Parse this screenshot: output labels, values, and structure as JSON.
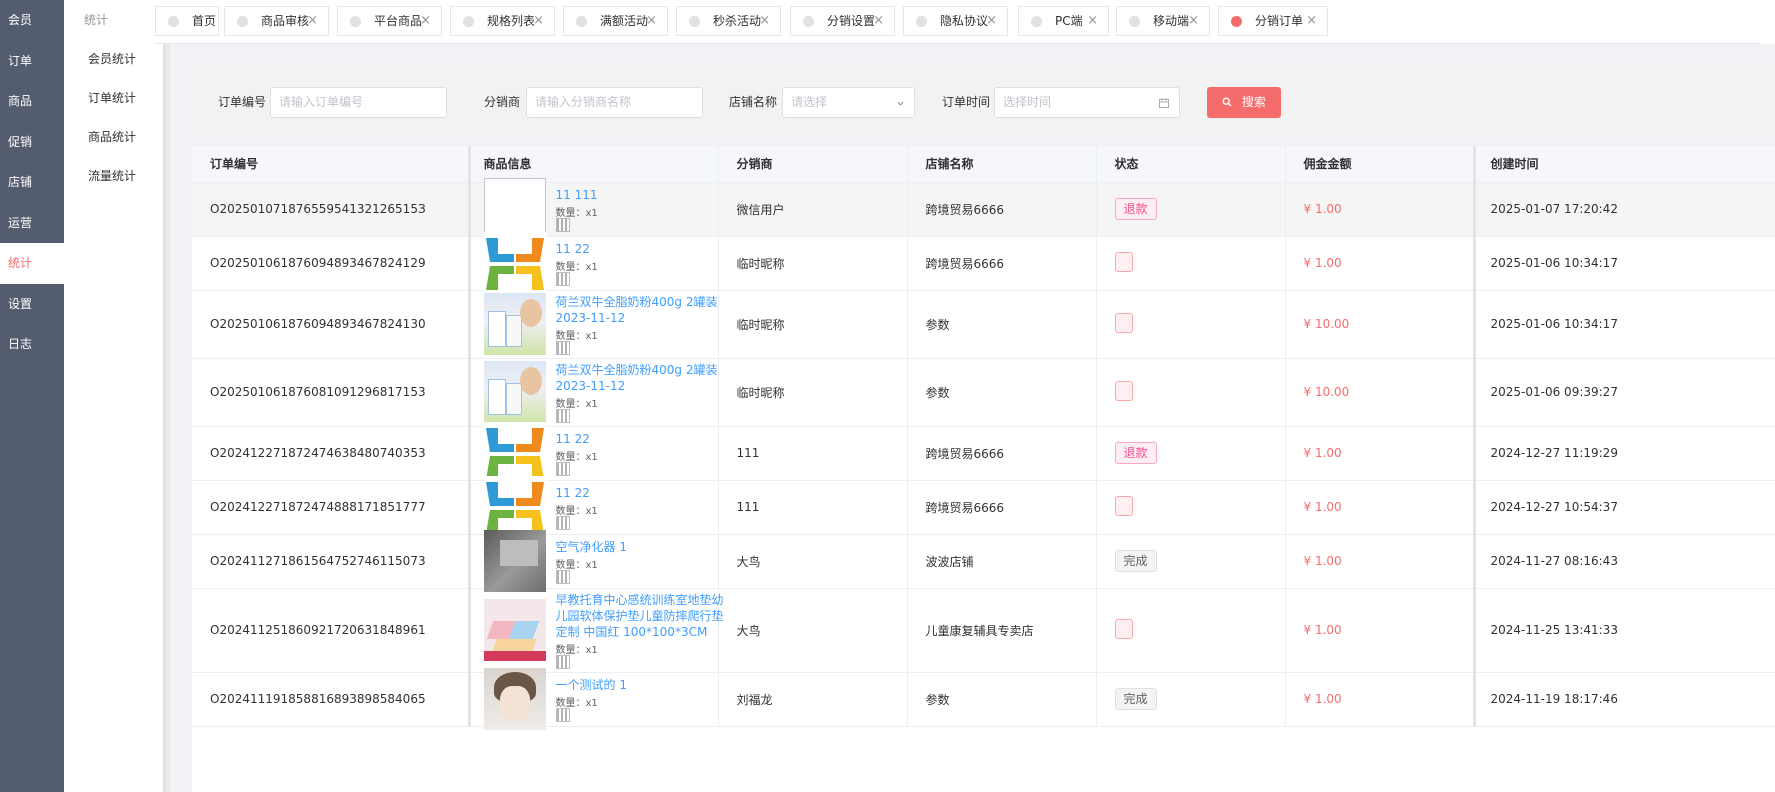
{
  "main_nav": [
    {
      "label": "会员",
      "active": false
    },
    {
      "label": "订单",
      "active": false
    },
    {
      "label": "商品",
      "active": false
    },
    {
      "label": "促销",
      "active": false
    },
    {
      "label": "店铺",
      "active": false
    },
    {
      "label": "运营",
      "active": false
    },
    {
      "label": "统计",
      "active": true
    },
    {
      "label": "设置",
      "active": false
    },
    {
      "label": "日志",
      "active": false
    }
  ],
  "sub_nav": {
    "heading": "统计",
    "items": [
      "会员统计",
      "订单统计",
      "商品统计",
      "流量统计"
    ]
  },
  "tabs": [
    {
      "label": "首页",
      "closable": false,
      "active": false
    },
    {
      "label": "商品审核",
      "closable": true,
      "active": false
    },
    {
      "label": "平台商品",
      "closable": true,
      "active": false
    },
    {
      "label": "规格列表",
      "closable": true,
      "active": false
    },
    {
      "label": "满额活动",
      "closable": true,
      "active": false
    },
    {
      "label": "秒杀活动",
      "closable": true,
      "active": false
    },
    {
      "label": "分销设置",
      "closable": true,
      "active": false
    },
    {
      "label": "隐私协议",
      "closable": true,
      "active": false
    },
    {
      "label": "PC端",
      "closable": true,
      "active": false
    },
    {
      "label": "移动端",
      "closable": true,
      "active": false
    },
    {
      "label": "分销订单",
      "closable": true,
      "active": true
    }
  ],
  "close_glyph": "×",
  "search": {
    "order_no_label": "订单编号",
    "order_no_placeholder": "请输入订单编号",
    "distributor_label": "分销商",
    "distributor_placeholder": "请输入分销商名称",
    "store_label": "店铺名称",
    "store_placeholder": "请选择",
    "time_label": "订单时间",
    "time_placeholder": "选择时间",
    "search_button": "搜索"
  },
  "table": {
    "columns": [
      "订单编号",
      "商品信息",
      "分销商",
      "店铺名称",
      "状态",
      "佣金金额",
      "创建时间"
    ],
    "qty_label": "数量：x1",
    "rows": [
      {
        "order_no": "O20250107187655954132126515З",
        "title": "11 111",
        "image": "broken",
        "distributor": "微信用户",
        "store": "跨境贸易6666",
        "status": "退款",
        "status_type": "refund",
        "commission": "¥ 1.00",
        "created": "2025-01-07 17:20:42"
      },
      {
        "order_no": "O20250106187609489346782412​9",
        "title": "11 22",
        "image": "arrows",
        "distributor": "临时昵称",
        "store": "跨境贸易6666",
        "status": "",
        "status_type": "empty",
        "commission": "¥ 1.00",
        "created": "2025-01-06 10:34:17"
      },
      {
        "order_no": "O202501061876094893467824130",
        "title": "荷兰双牛全脂奶粉400g 2罐装 2023-11-12",
        "image": "milk",
        "distributor": "临时昵称",
        "store": "参数",
        "status": "",
        "status_type": "empty",
        "commission": "¥ 10.00",
        "created": "2025-01-06 10:34:17"
      },
      {
        "order_no": "O202501061876081091296817153",
        "title": "荷兰双牛全脂奶粉400g 2罐装 2023-11-12",
        "image": "milk",
        "distributor": "临时昵称",
        "store": "参数",
        "status": "",
        "status_type": "empty",
        "commission": "¥ 10.00",
        "created": "2025-01-06 09:39:27"
      },
      {
        "order_no": "O202412271872474638480740353",
        "title": "11 22",
        "image": "arrows",
        "distributor": "111",
        "store": "跨境贸易6666",
        "status": "退款",
        "status_type": "refund",
        "commission": "¥ 1.00",
        "created": "2024-12-27 11:19:29"
      },
      {
        "order_no": "O202412271872474888171851777",
        "title": "11 22",
        "image": "arrows",
        "distributor": "111",
        "store": "跨境贸易6666",
        "status": "",
        "status_type": "empty",
        "commission": "¥ 1.00",
        "created": "2024-12-27 10:54:37"
      },
      {
        "order_no": "O202411271861564752746115073",
        "title": "空气净化器 1",
        "image": "purifier",
        "distributor": "大鸟",
        "store": "波波店铺",
        "status": "完成",
        "status_type": "done",
        "commission": "¥ 1.00",
        "created": "2024-11-27 08:16:43"
      },
      {
        "order_no": "O202411251860921720631848961",
        "title": "早教托育中心感统训练室地垫幼儿园软体保护垫儿童防摔爬行垫定制 中国红 100*100*3CM",
        "image": "mat",
        "distributor": "大鸟",
        "store": "儿童康复辅具专卖店",
        "status": "",
        "status_type": "empty",
        "commission": "¥ 1.00",
        "created": "2024-11-25 13:41:33"
      },
      {
        "order_no": "O202411191858816893898584065",
        "title": "一个测试的 1",
        "image": "anime",
        "distributor": "刘福龙",
        "store": "参数",
        "status": "完成",
        "status_type": "done",
        "commission": "¥ 1.00",
        "created": "2024-11-19 18:17:46"
      }
    ]
  },
  "colors": {
    "accent": "#f56c6c",
    "nav_bg": "#545c6f",
    "link": "#409eff"
  },
  "icons": {
    "search_button": "search-icon",
    "store_select": "chevron-down-icon",
    "time_input": "calendar-icon",
    "tab_marker": "dot-icon",
    "tab_close": "close-icon",
    "product_code": "qrcode-icon"
  }
}
